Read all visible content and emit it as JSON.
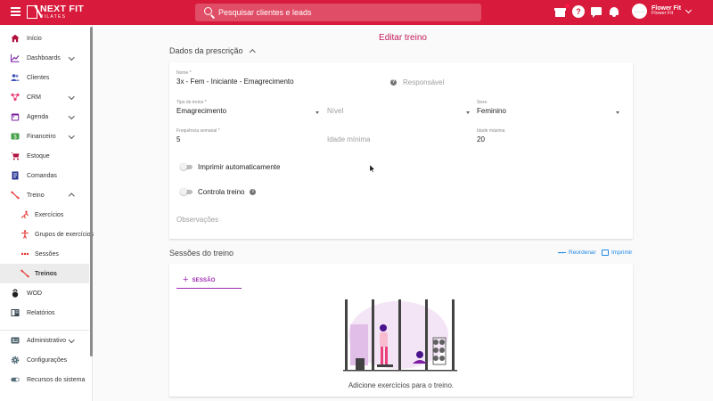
{
  "topbar": {
    "logo_main": "NEXT FIT",
    "logo_sub": "PILATES",
    "search_placeholder": "Pesquisar clientes e leads",
    "icons": [
      "menu-icon",
      "gift-icon",
      "help-icon",
      "chat-icon",
      "bell-icon"
    ],
    "user_name": "Flower Fit",
    "user_sub": "Flower Fit",
    "avatar_text": "———"
  },
  "sidebar": {
    "items": [
      {
        "label": "Início",
        "icon": "home-icon"
      },
      {
        "label": "Dashboards",
        "icon": "chart-icon"
      },
      {
        "label": "Clientes",
        "icon": "people-icon"
      },
      {
        "label": "CRM",
        "icon": "crm-icon"
      },
      {
        "label": "Agenda",
        "icon": "calendar-icon"
      },
      {
        "label": "Financeiro",
        "icon": "money-icon"
      },
      {
        "label": "Estoque",
        "icon": "cart-icon"
      },
      {
        "label": "Comandas",
        "icon": "receipt-icon"
      },
      {
        "label": "Treino",
        "icon": "dumbbell-icon"
      },
      {
        "label": "Exercícios",
        "icon": "exercise-icon"
      },
      {
        "label": "Grupos de exercícios",
        "icon": "body-icon"
      },
      {
        "label": "Sessões",
        "icon": "dots-icon"
      },
      {
        "label": "Treinos",
        "icon": "dumbbell-icon"
      },
      {
        "label": "WOD",
        "icon": "kettlebell-icon"
      },
      {
        "label": "Relatórios",
        "icon": "report-icon"
      },
      {
        "label": "Administrativo",
        "icon": "admin-icon"
      },
      {
        "label": "Configurações",
        "icon": "gear-icon"
      },
      {
        "label": "Recursos do sistema",
        "icon": "toggle-icon"
      }
    ]
  },
  "main": {
    "title": "Editar treino",
    "prescription_header": "Dados da prescrição",
    "fields": {
      "nome_label": "Nome *",
      "nome_value": "3x - Fem - Iniciante - Emagrecimento",
      "responsavel_placeholder": "Responsável",
      "tipo_label": "Tipo de treino *",
      "tipo_value": "Emagrecimento",
      "nivel_placeholder": "Nível",
      "sexo_label": "Sexo",
      "sexo_value": "Feminino",
      "freq_label": "Frequência semanal *",
      "freq_value": "5",
      "idade_min_placeholder": "Idade mínima",
      "idade_max_label": "Idade máxima",
      "idade_max_value": "20",
      "obs_placeholder": "Observações"
    },
    "toggles": {
      "print_label": "Imprimir automaticamente",
      "controla_label": "Controla treino"
    },
    "sessions_header": "Sessões do treino",
    "reorder_label": "Reordenar",
    "print_label": "Imprimir",
    "tab_label": "SESSÃO",
    "empty_text": "Adicione exercícios para o treino."
  },
  "colors": {
    "brand": "#d81b3c",
    "title": "#c2185b",
    "accent": "#9c27b0",
    "link": "#1e88e5"
  }
}
